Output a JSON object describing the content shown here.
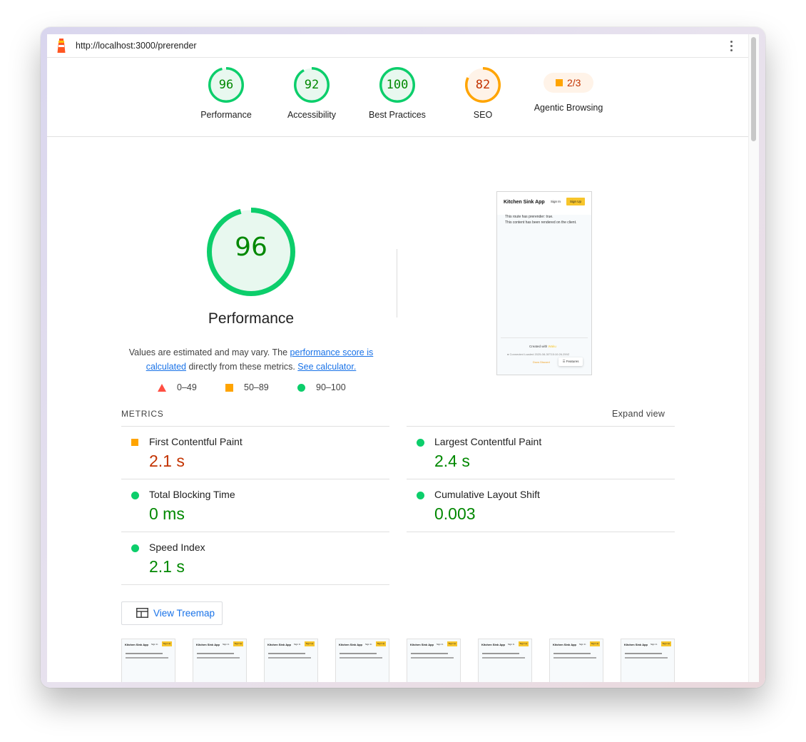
{
  "browser": {
    "url": "http://localhost:3000/prerender"
  },
  "summary": [
    {
      "score": "96",
      "label": "Performance",
      "color": "#0cce6b",
      "text_color": "#008800",
      "fraction": 0.96
    },
    {
      "score": "92",
      "label": "Accessibility",
      "color": "#0cce6b",
      "text_color": "#008800",
      "fraction": 0.92
    },
    {
      "score": "100",
      "label": "Best Practices",
      "color": "#0cce6b",
      "text_color": "#008800",
      "fraction": 1.0
    },
    {
      "score": "82",
      "label": "SEO",
      "color": "#ffa400",
      "text_color": "#c33300",
      "fraction": 0.82
    },
    {
      "fraction_text": "2/3",
      "label": "Agentic Browsing",
      "color": "#ffa400"
    }
  ],
  "performance": {
    "score": "96",
    "fraction": 0.96,
    "title": "Performance",
    "desc_prefix": "Values are estimated and may vary. The ",
    "desc_link1": "performance score is calculated",
    "desc_mid": " directly from these metrics. ",
    "desc_link2": "See calculator.",
    "legend": [
      "0–49",
      "50–89",
      "90–100"
    ],
    "colors": {
      "fail": "#ff4e42",
      "average": "#ffa400",
      "pass": "#0cce6b",
      "pass_text": "#008800",
      "average_text": "#c33300"
    }
  },
  "screenshot": {
    "app_title": "Kitchen Sink App",
    "sign_in": "Sign In",
    "sign_up": "Sign Up",
    "line1": "This route has prerender: true.",
    "line2": "This content has been rendered on the client.",
    "created_with": "Created with",
    "brand": "Waku",
    "connected": "● Connected    Loaded 2025-08-30T15:10:26.259Z",
    "links": "Docs   Discord",
    "features": "☰ Features"
  },
  "metrics": {
    "header": "METRICS",
    "expand": "Expand view",
    "items": [
      {
        "name": "First Contentful Paint",
        "value": "2.1 s",
        "rating": "average"
      },
      {
        "name": "Largest Contentful Paint",
        "value": "2.4 s",
        "rating": "pass"
      },
      {
        "name": "Total Blocking Time",
        "value": "0 ms",
        "rating": "pass"
      },
      {
        "name": "Cumulative Layout Shift",
        "value": "0.003",
        "rating": "pass"
      },
      {
        "name": "Speed Index",
        "value": "2.1 s",
        "rating": "pass"
      }
    ]
  },
  "treemap": {
    "label": "View Treemap"
  },
  "filmstrip": {
    "count": 8,
    "app_title": "Kitchen Sink App",
    "sign_in": "Sign In",
    "sign_up": "Sign Up"
  }
}
